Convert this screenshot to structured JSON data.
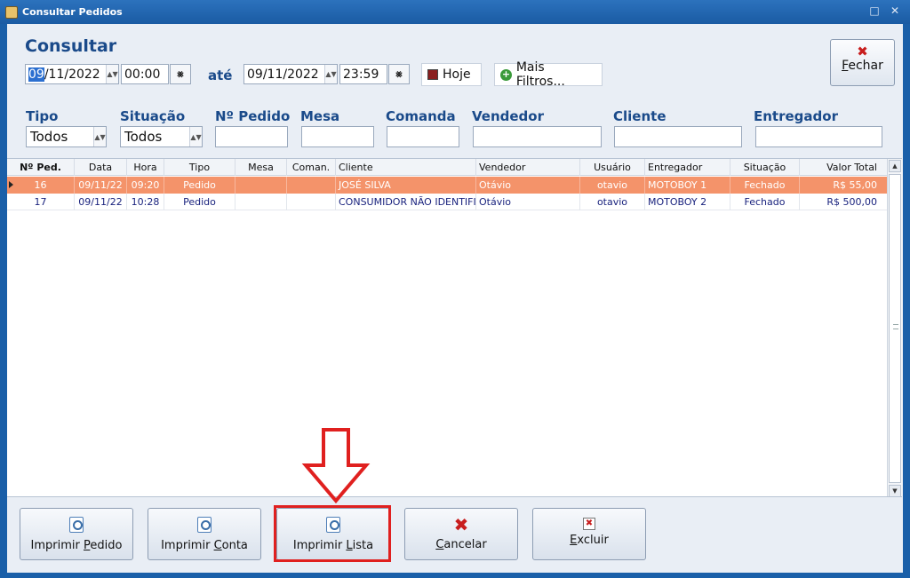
{
  "window": {
    "title": "Consultar Pedidos",
    "controls": "□ ✕"
  },
  "header": {
    "title": "Consultar",
    "date_from_day": "09",
    "date_from_rest": "/11/2022",
    "time_from": "00:00",
    "ate_label": "até",
    "date_to": "09/11/2022",
    "time_to": "23:59",
    "hoje_label": "Hoje",
    "mais_filtros_label": "Mais Filtros...",
    "fechar_first": "F",
    "fechar_rest": "echar"
  },
  "filters": {
    "tipo_label": "Tipo",
    "tipo_value": "Todos",
    "situacao_label": "Situação",
    "situacao_value": "Todos",
    "pedido_label": "Nº Pedido",
    "mesa_label": "Mesa",
    "comanda_label": "Comanda",
    "vendedor_label": "Vendedor",
    "cliente_label": "Cliente",
    "entregador_label": "Entregador"
  },
  "grid": {
    "columns": [
      "Nº Ped.",
      "Data",
      "Hora",
      "Tipo",
      "Mesa",
      "Coman.",
      "Cliente",
      "Vendedor",
      "Usuário",
      "Entregador",
      "Situação",
      "Valor Total"
    ],
    "rows": [
      [
        "16",
        "09/11/22",
        "09:20",
        "Pedido",
        "",
        "",
        "JOSÉ SILVA",
        "Otávio",
        "otavio",
        "MOTOBOY 1",
        "Fechado",
        "R$ 55,00"
      ],
      [
        "17",
        "09/11/22",
        "10:28",
        "Pedido",
        "",
        "",
        "CONSUMIDOR NÃO IDENTIFICADO",
        "Otávio",
        "otavio",
        "MOTOBOY 2",
        "Fechado",
        "R$ 500,00"
      ]
    ]
  },
  "buttons": {
    "imprimir_pedido": {
      "pre": "Imprimir ",
      "u": "P",
      "post": "edido"
    },
    "imprimir_conta": {
      "pre": "Imprimir ",
      "u": "C",
      "post": "onta"
    },
    "imprimir_lista": {
      "pre": "Imprimir ",
      "u": "L",
      "post": "ista"
    },
    "cancelar": {
      "pre": "",
      "u": "C",
      "post": "ancelar"
    },
    "excluir": {
      "pre": "",
      "u": "E",
      "post": "xcluir"
    }
  },
  "colors": {
    "selected_row": "#f4936a",
    "title_blue": "#1a4a8a",
    "highlight_red": "#e0201f"
  }
}
